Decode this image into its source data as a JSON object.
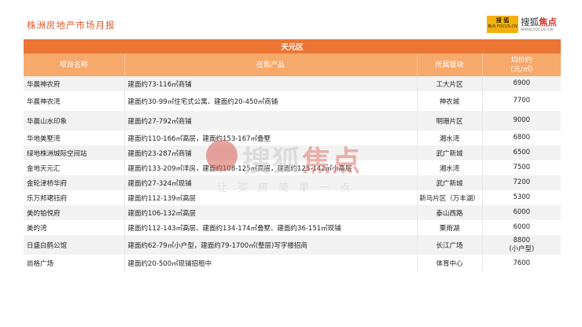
{
  "header": {
    "title": "株洲房地产市场月报",
    "logo_left_main": "搜 狐",
    "logo_left_sub": "焦点 FOCUS.CN",
    "logo_right_prefix": "搜狐",
    "logo_right_highlight": "焦点",
    "logo_right_sub": "WWW.FOCUS.CN"
  },
  "table": {
    "district": "天元区",
    "columns": {
      "name": "项目名称",
      "product": "在售产品",
      "area": "所属版块",
      "price_line1": "均价约",
      "price_line2": "(元/㎡)"
    },
    "rows": [
      {
        "name": "华晨神农府",
        "product": "建面约73-116㎡商铺",
        "area": "工大片区",
        "price": "6900",
        "price_note": ""
      },
      {
        "name": "华晨神农湾",
        "product": "建面约30-99㎡住宅式公寓、建面约20-450㎡商铺",
        "area": "神农城",
        "price": "7700",
        "price_note": ""
      },
      {
        "name": "华晨山水印象",
        "product": "建面约27-792㎡商铺",
        "area": "明珊片区",
        "price": "9000",
        "price_note": ""
      },
      {
        "name": "华地美墅湾",
        "product": "建面约110-166㎡高层，建面约153-167㎡叠墅",
        "area": "湘水湾",
        "price": "6800",
        "price_note": ""
      },
      {
        "name": "绿地株洲城际空间站",
        "product": "建面约23-287㎡商铺",
        "area": "武广新城",
        "price": "6500",
        "price_note": ""
      },
      {
        "name": "金地天元汇",
        "product": "建面约133-209㎡洋房，建面约108-125㎡高层，建面约125-142㎡小高层",
        "area": "湘水湾",
        "price": "7500",
        "price_note": ""
      },
      {
        "name": "金轮津桥华府",
        "product": "建面约27-324㎡现铺",
        "area": "武广新城",
        "price": "7200",
        "price_note": ""
      },
      {
        "name": "乐万邦珺钰府",
        "product": "建面约112-139㎡高层",
        "area": "新马片区（万丰湖）",
        "price": "5300",
        "price_note": ""
      },
      {
        "name": "美的铂悦府",
        "product": "建面约106-132㎡高层",
        "area": "泰山西路",
        "price": "6000",
        "price_note": ""
      },
      {
        "name": "美的湾",
        "product": "建面约112-143㎡高层、建面约134-174㎡叠墅、建面约36-151㎡现铺",
        "area": "栗雨湖",
        "price": "6000",
        "price_note": ""
      },
      {
        "name": "日盛白鹤公馆",
        "product": "建面约62-79㎡小户型，建面约79-1700㎡(整层)写字楼招商",
        "area": "长江广场",
        "price": "8800",
        "price_note": "(小户型)"
      },
      {
        "name": "尚格广场",
        "product": "建面约20-500㎡现铺招租中",
        "area": "体育中心",
        "price": "7600",
        "price_note": ""
      }
    ]
  },
  "watermark": {
    "brand": "搜狐",
    "highlight": "焦点",
    "slogan": "让买房简单一点"
  },
  "colors": {
    "title": "#e05a2a",
    "district_bar": "#ed7533",
    "header_row": "#f7a96b",
    "row_alt": "#f2f2f2"
  }
}
